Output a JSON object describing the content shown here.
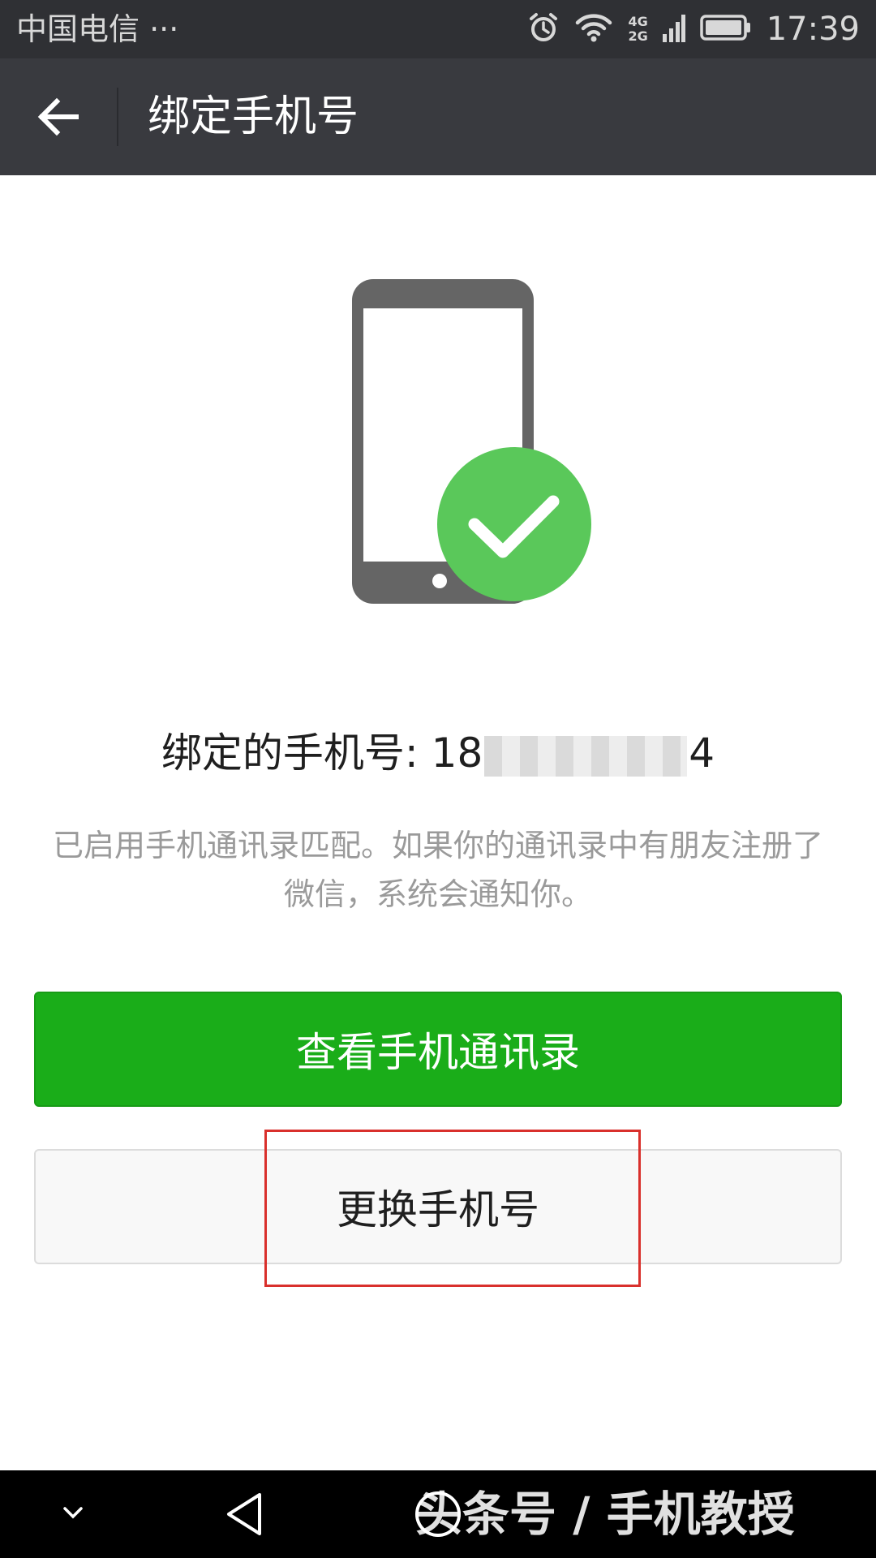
{
  "status_bar": {
    "carrier": "中国电信 ···",
    "network_top": "4G",
    "network_bottom": "2G",
    "time": "17:39"
  },
  "header": {
    "title": "绑定手机号"
  },
  "main": {
    "bound_label": "绑定的手机号: 18",
    "bound_suffix": "4",
    "description": "已启用手机通讯录匹配。如果你的通讯录中有朋友注册了微信，系统会通知你。",
    "primary_button": "查看手机通讯录",
    "secondary_button": "更换手机号"
  },
  "watermark": {
    "text": "头条号 / 手机教授"
  },
  "colors": {
    "status_bar": "#2f3034",
    "title_bar": "#393a3f",
    "accent_green": "#1aad19",
    "check_circle": "#5ac85a",
    "phone_gray": "#656565",
    "highlight_red": "#d9302c"
  },
  "icons": {
    "back": "arrow-left-icon",
    "illustration_phone": "smartphone-icon",
    "illustration_check": "check-circle-icon",
    "alarm": "alarm-icon",
    "wifi": "wifi-icon",
    "signal": "signal-icon",
    "battery": "battery-icon",
    "nav_down": "chevron-down-icon",
    "nav_back": "triangle-back-icon",
    "nav_home": "circle-home-icon"
  }
}
